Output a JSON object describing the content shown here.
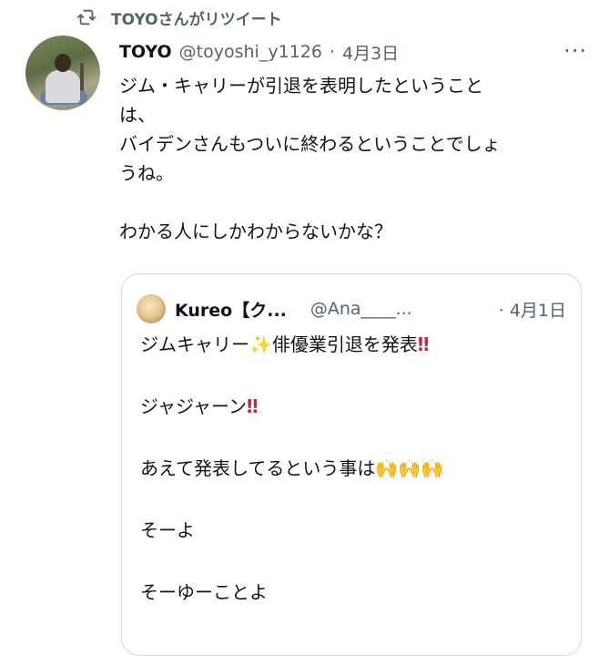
{
  "retweet": {
    "icon": "retweet-icon",
    "text": "TOYOさんがリツイート"
  },
  "tweet": {
    "name": "TOYO",
    "handle": "@toyoshi_y1126",
    "dot": "·",
    "date": "4月3日",
    "more_icon": "more-icon",
    "more": "···",
    "lines": [
      "ジム・キャリーが引退を表明したということ",
      "は、",
      "バイデンさんもついに終わるということでしょ",
      "うね。",
      "わかる人にしかわからないかな？"
    ]
  },
  "quote": {
    "name": "Kureo【ク...",
    "handle": "@Ana____...",
    "dot": "·",
    "date": "4月1日",
    "line1": "ジムキャリー",
    "line1_emoji": "✨",
    "line1_rest": "俳優業引退を発表",
    "line1_bang": "‼",
    "line2": "ジャジャーン",
    "line2_bang": "‼",
    "line3": "あえて発表してるという事は",
    "line3_emoji": "🙌🙌🙌",
    "line4": "そーよ",
    "line5": "そーゆーことよ"
  }
}
